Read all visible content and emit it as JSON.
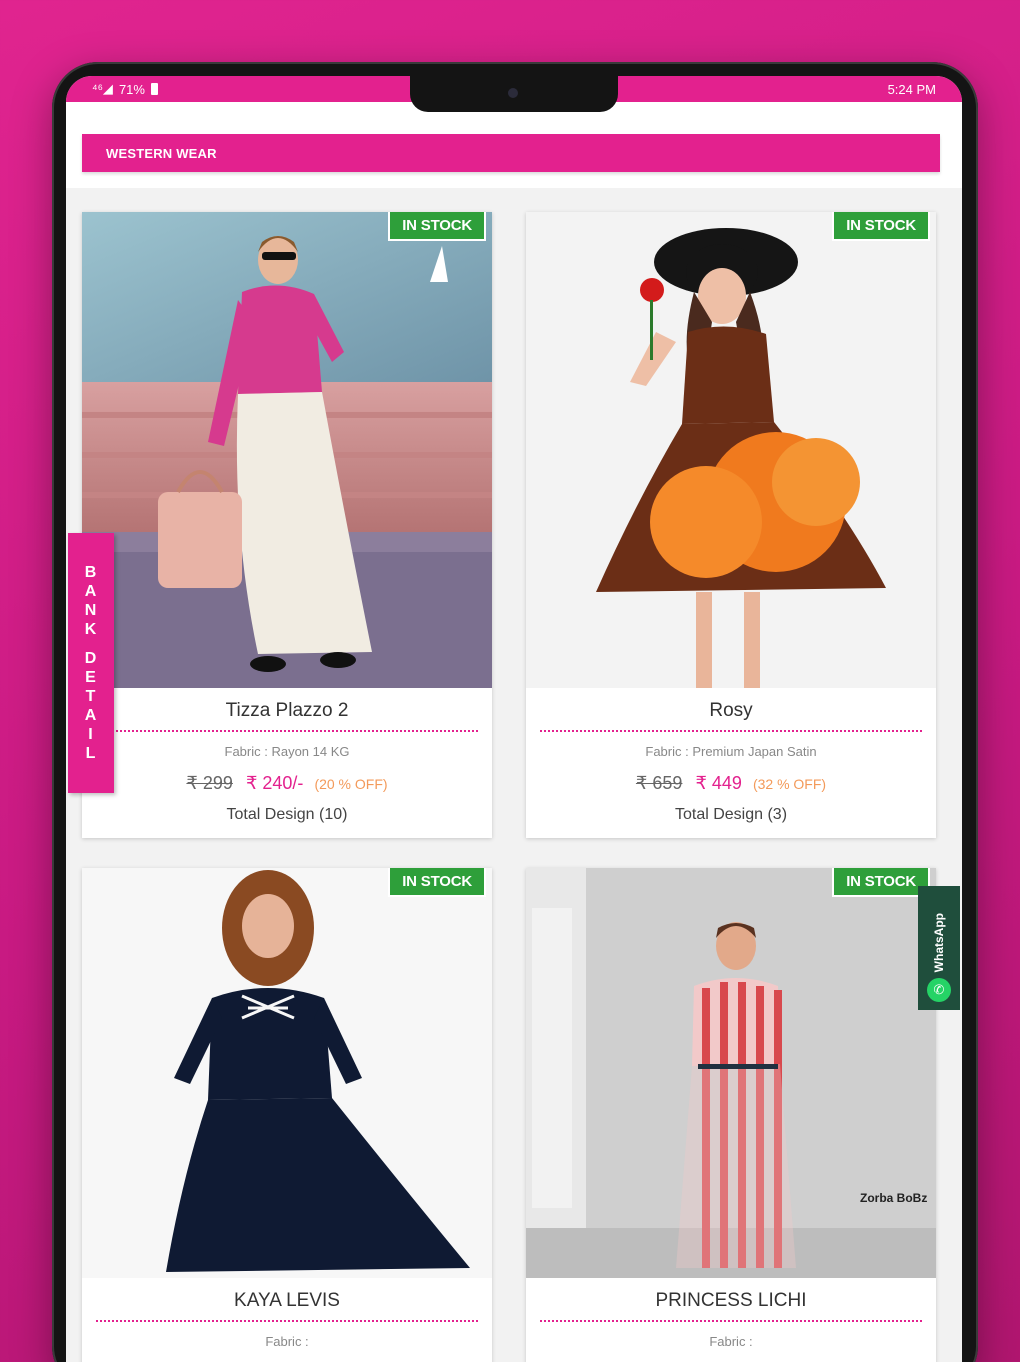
{
  "status": {
    "signal": "71%",
    "time": "5:24 PM"
  },
  "section": {
    "title": "WESTERN WEAR"
  },
  "side_tabs": {
    "bank": [
      "B",
      "A",
      "N",
      "K",
      " ",
      "D",
      "E",
      "T",
      "A",
      "I",
      "L"
    ],
    "whatsapp": "WhatsApp"
  },
  "products": [
    {
      "name": "Tizza Plazzo 2",
      "badge": "IN STOCK",
      "fabric": "Fabric : Rayon 14 KG",
      "old_price": "₹ 299",
      "new_price": "₹ 240/-",
      "discount": "(20 % OFF)",
      "total": "Total Design (10)",
      "image_label": ""
    },
    {
      "name": "Rosy",
      "badge": "IN STOCK",
      "fabric": "Fabric : Premium Japan Satin",
      "old_price": "₹ 659",
      "new_price": "₹ 449",
      "discount": "(32 % OFF)",
      "total": "Total Design (3)",
      "image_label": ""
    },
    {
      "name": "KAYA LEVIS",
      "badge": "IN STOCK",
      "fabric": "Fabric :",
      "image_label": ""
    },
    {
      "name": "PRINCESS LICHI",
      "badge": "IN STOCK",
      "fabric": "Fabric :",
      "image_label": "Zorba BoBz"
    }
  ],
  "colors": {
    "brand": "#e3218e",
    "stock": "#2e9f3a",
    "whatsapp_bg": "#1f4e3c"
  }
}
